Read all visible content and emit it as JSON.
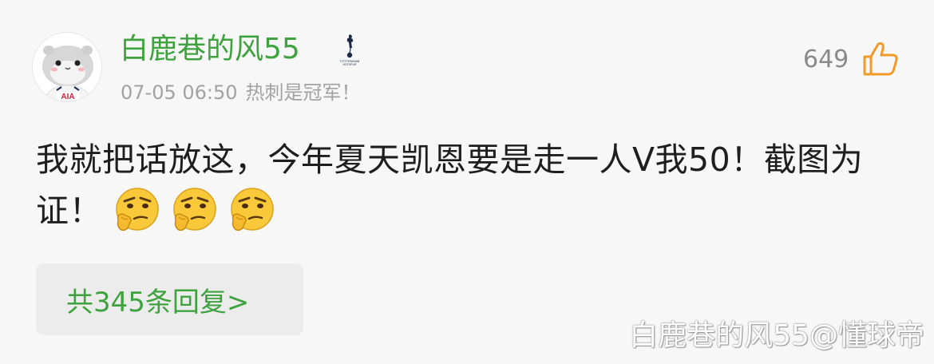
{
  "comment": {
    "username": "白鹿巷的风55",
    "team_badge_icon": "tottenham-cockerel-icon",
    "timestamp": "07-05 06:50",
    "tagline": "热刺是冠军！",
    "likes": "649",
    "like_icon": "thumbs-up-icon",
    "text": "我就把话放这，今年夏天凯恩要是走一人V我50！截图为证！",
    "emojis": [
      "thinking-face-icon",
      "thinking-face-icon",
      "thinking-face-icon"
    ],
    "replies_label": "共345条回复>"
  },
  "watermark": "白鹿巷的风55@懂球帝",
  "colors": {
    "username": "#3ea33e",
    "reply_link": "#3ea33e",
    "meta_text": "#a2a2a2",
    "like_icon": "#f29a28",
    "background": "#f7f7f7",
    "reply_box": "#ececec"
  }
}
